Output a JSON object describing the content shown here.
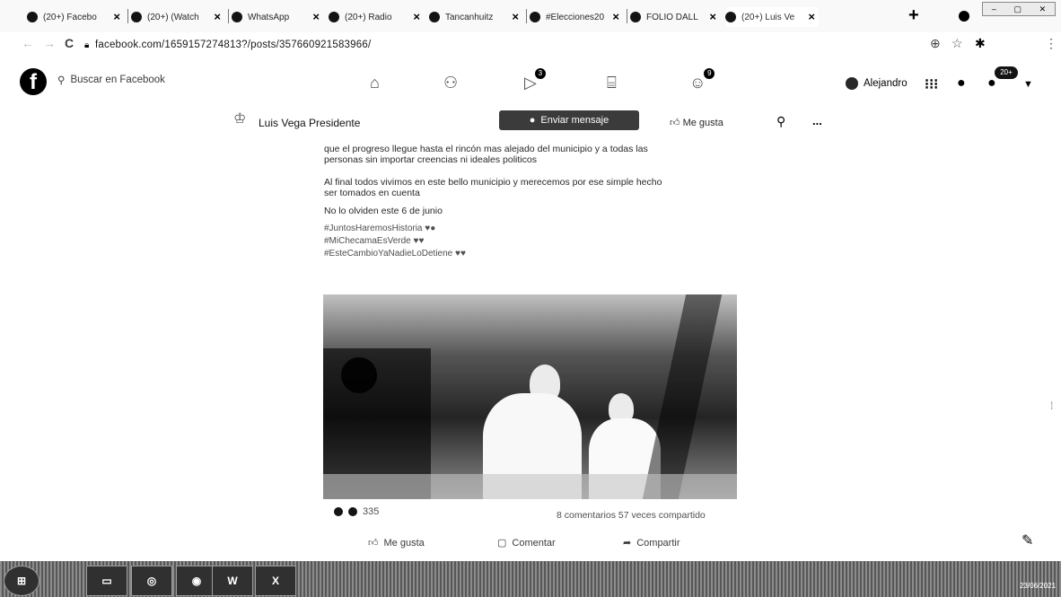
{
  "browser": {
    "tabs": [
      {
        "label": "(20+) Facebo"
      },
      {
        "label": "(20+) (Watch"
      },
      {
        "label": "WhatsApp"
      },
      {
        "label": "(20+) Radio"
      },
      {
        "label": "Tancanhuitz"
      },
      {
        "label": "#Elecciones20"
      },
      {
        "label": "FOLIO DALL"
      },
      {
        "label": "(20+) Luis Ve"
      }
    ],
    "new_tab": "+",
    "url": "facebook.com/1659157274813?/posts/357660921583966/"
  },
  "facebook": {
    "logo": "f",
    "search_placeholder": "Buscar en Facebook",
    "nav_badges": {
      "groups": "3",
      "gaming": "9"
    },
    "user_name": "Alejandro",
    "notifications_badge": "20+"
  },
  "page_bar": {
    "page_name": "Luis Vega Presidente",
    "send_message": "Enviar mensaje",
    "like": "Me gusta",
    "more": "..."
  },
  "post": {
    "lines": [
      "que el progreso llegue hasta el rincón mas alejado del municipio y a todas las",
      "personas sin importar creencias ni ideales politicos",
      "Al final todos vivimos en este bello municipio y merecemos por ese simple hecho",
      "ser tomados en cuenta",
      "No lo olviden este 6 de junio"
    ],
    "hashtags": [
      "#JuntosHaremosHistoria",
      "#MiChecamaEsVerde",
      "#EsteCambioYaNadieLoDetiene"
    ],
    "reactions_count": "335",
    "stats": "8 comentarios 57 veces compartido",
    "actions": {
      "like": "Me gusta",
      "comment": "Comentar",
      "share": "Compartir"
    }
  },
  "taskbar": {
    "clock": "23/06/2021"
  }
}
